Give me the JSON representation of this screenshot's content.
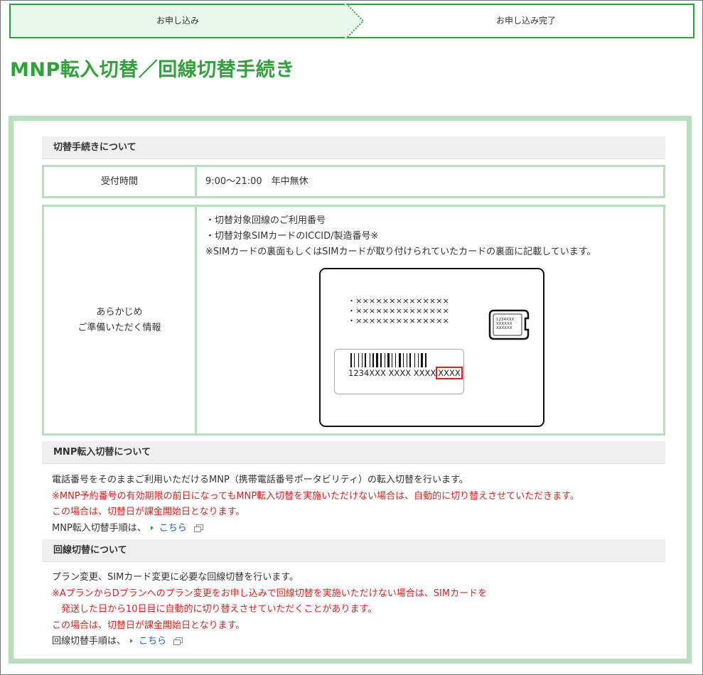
{
  "steps": [
    {
      "label": "お申し込み",
      "active": true
    },
    {
      "label": "お申し込み完了",
      "active": false
    }
  ],
  "page_title": "MNP転入切替／回線切替手続き",
  "colors": {
    "brand_green": "#2fa33a",
    "panel_border": "#b7dfbd",
    "red_text": "#e0201c",
    "link": "#1a5fc2"
  },
  "procedure": {
    "heading": "切替手続きについて",
    "hours_label": "受付時間",
    "hours_value": "9:00～21:00　年中無休",
    "prepare_label_1": "あらかじめ",
    "prepare_label_2": "ご準備いただく情報",
    "prepare_items": [
      "・切替対象回線のご利用番号",
      "・切替対象SIMカードのICCID/製造番号※"
    ],
    "prepare_note": "※SIMカードの裏面もしくはSIMカードが取り付けられていたカードの裏面に記載しています。",
    "card": {
      "lines": [
        "・××××××××××××××",
        "・××××××××××××××",
        "・××××××××××××××"
      ],
      "barcode_prefix": "1234XXX XXXX XXXX",
      "barcode_highlight": "XXXX",
      "chip_text": [
        "1234XXX",
        "XXXXXX",
        "XXXXXX"
      ]
    }
  },
  "mnp": {
    "heading": "MNP転入切替について",
    "line1": "電話番号をそのままご利用いただけるMNP（携帯電話番号ポータビリティ）の転入切替を行います。",
    "line2": "※MNP予約番号の有効期限の前日になってもMNP転入切替を実施いただけない場合は、自動的に切り替えさせていただきます。",
    "line3": "この場合は、切替日が課金開始日となります。",
    "link_prefix": "MNP転入切替手順は、",
    "link_label": "こちら"
  },
  "line_switch": {
    "heading": "回線切替について",
    "line1": "プラン変更、SIMカード変更に必要な回線切替を行います。",
    "line2": "※AプランからDプランへのプラン変更をお申し込みで回線切替を実施いただけない場合は、SIMカードを",
    "line3": "　発送した日から10日目に自動的に切り替えさせていただくことがあります。",
    "line4": "この場合は、切替日が課金開始日となります。",
    "link_prefix": "回線切替手順は、",
    "link_label": "こちら"
  },
  "icons": {
    "external": "external-window-icon",
    "arrow": "triangle-right-icon"
  }
}
